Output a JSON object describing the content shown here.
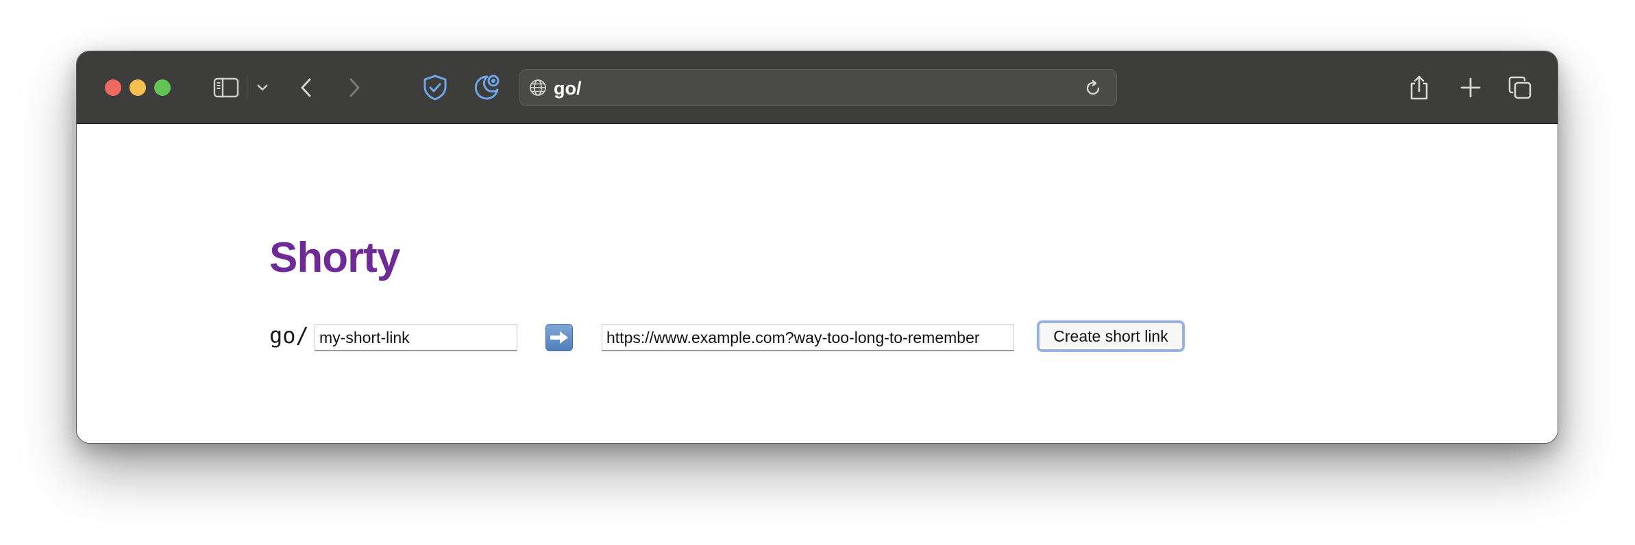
{
  "browser": {
    "address": "go/"
  },
  "page": {
    "title": "Shorty",
    "prefix": "go/",
    "short_link_value": "my-short-link",
    "arrow": "➡️",
    "long_url_value": "https://www.example.com?way-too-long-to-remember",
    "create_button_label": "Create short link"
  },
  "colors": {
    "title": "#6f2b95",
    "toolbar": "#3d3d3b",
    "button_focus_ring": "#8fb0ec"
  },
  "icons": {
    "sidebar": "sidebar-icon",
    "chevron": "chevron-down-icon",
    "back": "back-icon",
    "forward": "forward-icon",
    "shield": "shield-check-icon",
    "extension": "moon-extension-icon",
    "globe": "globe-icon",
    "reload": "reload-icon",
    "share": "share-icon",
    "new_tab": "plus-icon",
    "tabs": "tab-overview-icon"
  }
}
